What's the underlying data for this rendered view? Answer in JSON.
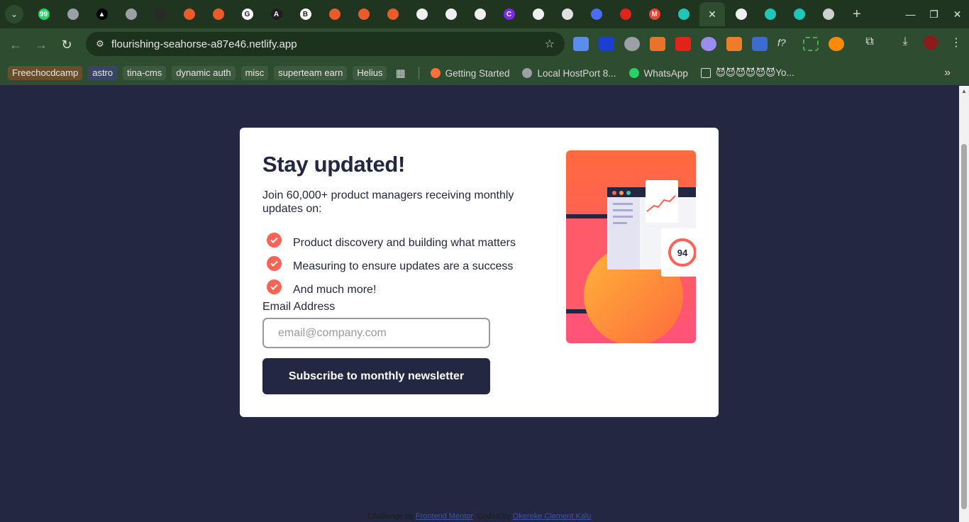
{
  "browser": {
    "url": "flourishing-seahorse-a87e46.netlify.app",
    "tabs": [
      {
        "icon": "whatsapp-icon",
        "color": "#25d366",
        "glyph": "99"
      },
      {
        "icon": "globe-icon",
        "color": "#9aa0a6",
        "glyph": ""
      },
      {
        "icon": "triangle-icon",
        "color": "#000000",
        "glyph": "▲"
      },
      {
        "icon": "globe-icon",
        "color": "#9aa0a6",
        "glyph": ""
      },
      {
        "icon": "calendar-icon",
        "color": "#2a2a2a",
        "glyph": ""
      },
      {
        "icon": "llama-icon",
        "color": "#e85c2b",
        "glyph": ""
      },
      {
        "icon": "llama-icon",
        "color": "#e85c2b",
        "glyph": ""
      },
      {
        "icon": "google-icon",
        "color": "#ffffff",
        "glyph": "G"
      },
      {
        "icon": "astro-icon",
        "color": "#1f1f1f",
        "glyph": "A"
      },
      {
        "icon": "brand-icon",
        "color": "#ffffff",
        "glyph": "B"
      },
      {
        "icon": "llama-icon",
        "color": "#e85c2b",
        "glyph": ""
      },
      {
        "icon": "llama-icon",
        "color": "#e85c2b",
        "glyph": ""
      },
      {
        "icon": "llama-icon",
        "color": "#e85c2b",
        "glyph": ""
      },
      {
        "icon": "github-icon",
        "color": "#f0f0f0",
        "glyph": ""
      },
      {
        "icon": "github-icon",
        "color": "#f0f0f0",
        "glyph": ""
      },
      {
        "icon": "github-icon",
        "color": "#f0f0f0",
        "glyph": ""
      },
      {
        "icon": "canva-icon",
        "color": "#7d2ae8",
        "glyph": "C"
      },
      {
        "icon": "github-icon",
        "color": "#f0f0f0",
        "glyph": ""
      },
      {
        "icon": "openai-icon",
        "color": "#e0e0e0",
        "glyph": ""
      },
      {
        "icon": "brand-icon",
        "color": "#4a6cf7",
        "glyph": ""
      },
      {
        "icon": "brand-icon",
        "color": "#e2231a",
        "glyph": ""
      },
      {
        "icon": "gmail-icon",
        "color": "#ea4335",
        "glyph": "M"
      },
      {
        "icon": "netlify-icon",
        "color": "#20c6b7",
        "glyph": ""
      }
    ],
    "tabs_after": [
      {
        "icon": "github-icon",
        "color": "#f0f0f0",
        "glyph": ""
      },
      {
        "icon": "netlify-icon",
        "color": "#20c6b7",
        "glyph": ""
      },
      {
        "icon": "netlify-icon",
        "color": "#20c6b7",
        "glyph": ""
      },
      {
        "icon": "chrome-icon",
        "color": "#d0d0d0",
        "glyph": ""
      }
    ],
    "bookmarks_chips": [
      {
        "label": "Freechocdcamp",
        "bg": "#6b4d2a"
      },
      {
        "label": "astro",
        "bg": "#3a4566"
      },
      {
        "label": "tina-cms",
        "bg": "#3d5a3e"
      },
      {
        "label": "dynamic auth",
        "bg": "#3d5a3e"
      },
      {
        "label": "misc",
        "bg": "#3d5a3e"
      },
      {
        "label": "superteam earn",
        "bg": "#3d5a3e"
      },
      {
        "label": "Helius",
        "bg": "#3d5a3e"
      }
    ],
    "bookmarks_links": [
      {
        "label": "Getting Started",
        "icon": "firefox-icon",
        "color": "#ff7139"
      },
      {
        "label": "Local HostPort 8...",
        "icon": "globe-icon",
        "color": "#9aa0a6"
      },
      {
        "label": "WhatsApp",
        "icon": "whatsapp-icon",
        "color": "#25d366"
      },
      {
        "label": "😈😈😈😈😈😈Yo...",
        "icon": "folder-icon",
        "color": "#d8d8d8"
      }
    ]
  },
  "card": {
    "title": "Stay updated!",
    "intro": "Join 60,000+ product managers receiving monthly updates on:",
    "features": [
      "Product discovery and building what matters",
      "Measuring to ensure updates are a success",
      "And much more!"
    ],
    "email_label": "Email Address",
    "email_placeholder": "email@company.com",
    "email_value": "",
    "button_label": "Subscribe to monthly newsletter",
    "illustration_score": "94",
    "accent": "#ff6257",
    "dark": "#242742"
  },
  "footer": {
    "challenge_text": "Challenge by",
    "challenge_link": "Frontend Mentor",
    "coded_text": ". Coded by",
    "coded_link": "Okereke Clement Kalu"
  }
}
